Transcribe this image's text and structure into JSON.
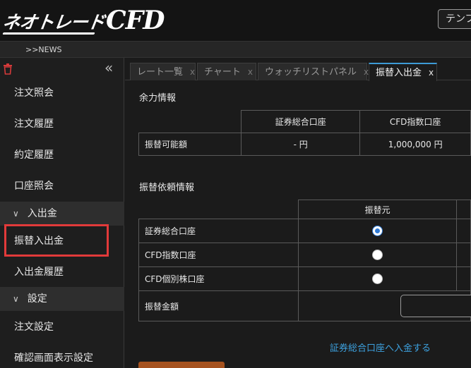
{
  "header": {
    "logo_jp": "ネオトレード",
    "logo_cfd": "CFD",
    "template_button": "テンプ"
  },
  "newsbar": {
    "link": ">>NEWS"
  },
  "sidebar": {
    "items": [
      {
        "label": "注文照会"
      },
      {
        "label": "注文履歴"
      },
      {
        "label": "約定履歴"
      },
      {
        "label": "口座照会"
      }
    ],
    "section_deposit": {
      "label": "入出金",
      "items": [
        {
          "label": "振替入出金"
        },
        {
          "label": "入出金履歴"
        }
      ]
    },
    "section_settings": {
      "label": "設定",
      "items": [
        {
          "label": "注文設定"
        },
        {
          "label": "確認画面表示設定"
        }
      ]
    }
  },
  "tabs": [
    {
      "label": "レート一覧",
      "close": "x"
    },
    {
      "label": "チャート",
      "close": "x"
    },
    {
      "label": "ウォッチリストパネル",
      "close": "x"
    },
    {
      "label": "振替入出金",
      "close": "x"
    }
  ],
  "balance": {
    "title": "余力情報",
    "col1": "証券総合口座",
    "col2": "CFD指数口座",
    "row_label": "振替可能額",
    "val1": "- 円",
    "val2": "1,000,000 円"
  },
  "request": {
    "title": "振替依頼情報",
    "col_header": "振替元",
    "rows": [
      {
        "label": "証券総合口座",
        "checked": true
      },
      {
        "label": "CFD指数口座",
        "checked": false
      },
      {
        "label": "CFD個別株口座",
        "checked": false
      }
    ],
    "amount_label": "振替金額"
  },
  "deposit_link": "証券総合口座へ入金する",
  "colors": {
    "accent": "#3d9bd6",
    "highlight": "#e23a3a",
    "button": "#a5521f"
  }
}
